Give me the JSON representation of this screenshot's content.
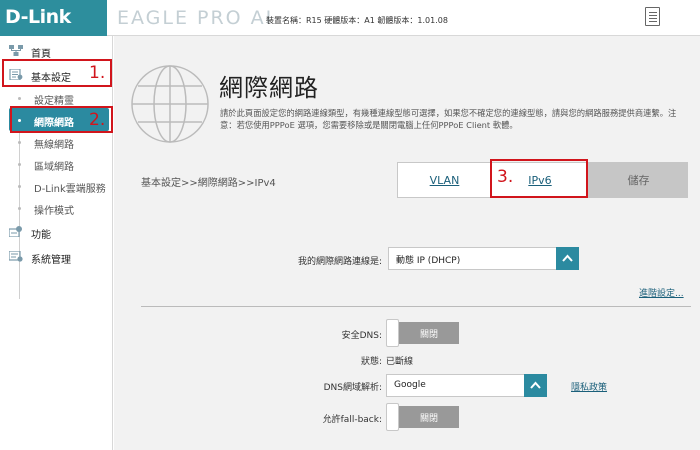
{
  "header": {
    "brand": "D-Link",
    "product": "EAGLE PRO AI",
    "device_info": "裝置名稱：R15  硬體版本：A1  韌體版本：1.01.08"
  },
  "sidebar": {
    "items": [
      {
        "label": "首頁"
      },
      {
        "label": "基本設定"
      },
      {
        "label": "設定精靈"
      },
      {
        "label": "網際網路"
      },
      {
        "label": "無線網路"
      },
      {
        "label": "區域網路"
      },
      {
        "label": "D-Link雲端服務"
      },
      {
        "label": "操作模式"
      },
      {
        "label": "功能"
      },
      {
        "label": "系統管理"
      }
    ]
  },
  "annotations": {
    "step1": "1.",
    "step2": "2.",
    "step3": "3."
  },
  "main": {
    "title": "網際網路",
    "description": "請於此頁面設定您的網路連線類型，有幾種連線型態可選擇，如果您不確定您的連線型態，請與您的網路服務提供商連繫。注意：若您使用PPPoE 選項，您需要移除或是關閉電腦上任何PPPoE Client 軟體。",
    "breadcrumb": "基本設定>>網際網路>>IPv4",
    "tabs": {
      "vlan": "VLAN",
      "ipv6": "IPv6",
      "save": "儲存"
    },
    "connection_label": "我的網際網路連線是:",
    "connection_value": "動態 IP (DHCP)",
    "advanced_link": "進階設定...",
    "secure_dns_label": "安全DNS:",
    "secure_dns_value": "關閉",
    "status_label": "狀態:",
    "status_value": "已斷線",
    "dns_resolve_label": "DNS網域解析:",
    "dns_resolve_value": "Google",
    "privacy_link": "隱私政策",
    "fallback_label": "允許fall-back:",
    "fallback_value": "關閉"
  },
  "colors": {
    "brand": "#2d8e9d",
    "accent": "#2b8aa0",
    "highlight": "#d1151c"
  }
}
